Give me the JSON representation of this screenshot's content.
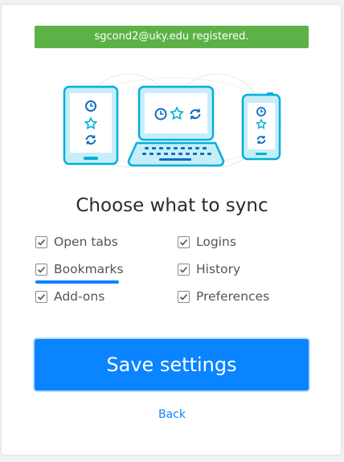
{
  "banner": {
    "text": "sgcond2@uky.edu registered."
  },
  "heading": "Choose what to sync",
  "options": [
    {
      "label": "Open tabs",
      "checked": true
    },
    {
      "label": "Logins",
      "checked": true
    },
    {
      "label": "Bookmarks",
      "checked": true
    },
    {
      "label": "History",
      "checked": true
    },
    {
      "label": "Add-ons",
      "checked": true
    },
    {
      "label": "Preferences",
      "checked": true
    }
  ],
  "save_button": {
    "label": "Save settings"
  },
  "back_link": {
    "label": "Back"
  },
  "colors": {
    "accent": "#0a84ff",
    "success": "#5cb246",
    "device_outline": "#00aedb",
    "device_fill": "#c6eef8"
  },
  "illustration_icons": [
    "clock-icon",
    "star-icon",
    "sync-icon"
  ]
}
